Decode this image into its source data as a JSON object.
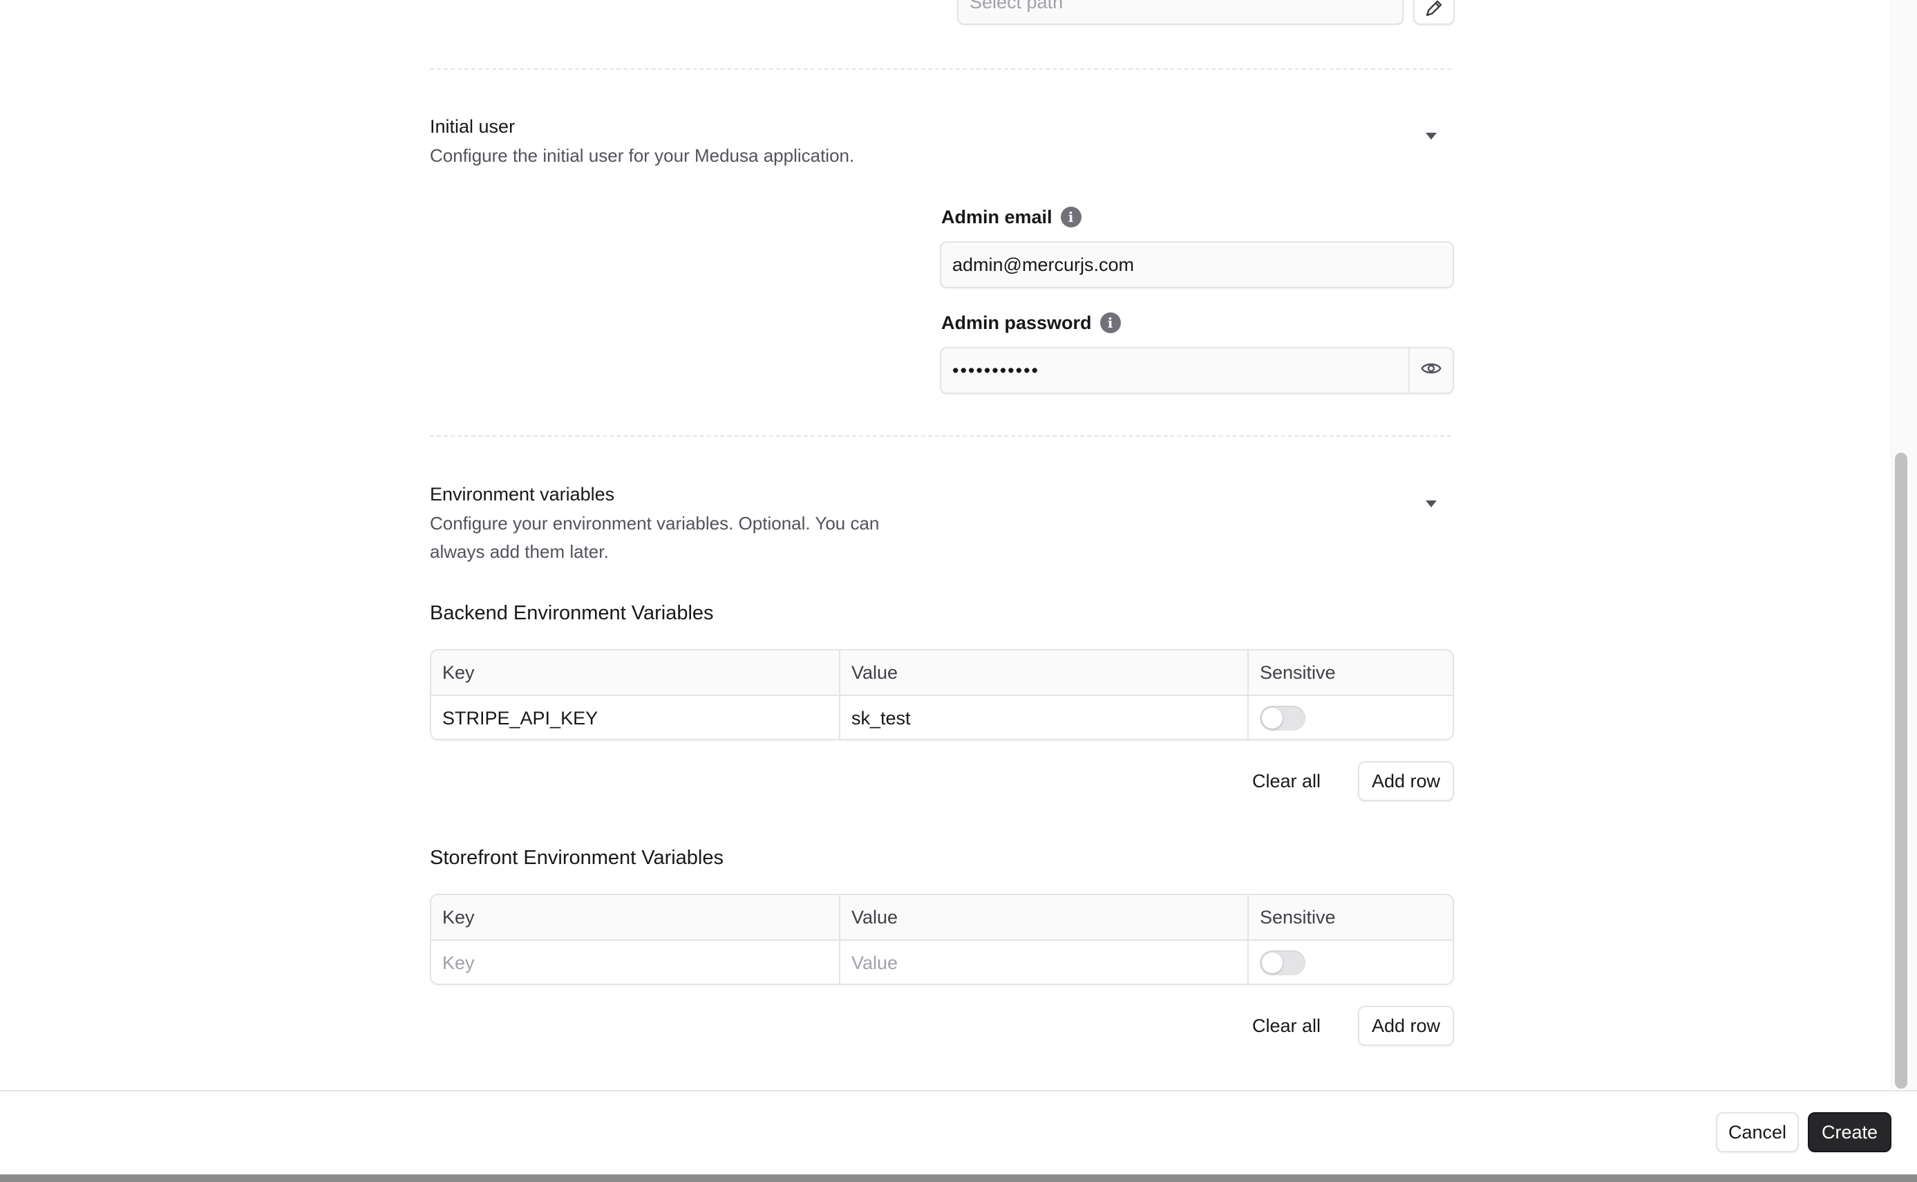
{
  "path_section": {
    "placeholder": "Select path"
  },
  "initial_user": {
    "title": "Initial user",
    "description": "Configure the initial user for your Medusa application.",
    "admin_email_label": "Admin email",
    "admin_email_value": "admin@mercurjs.com",
    "admin_password_label": "Admin password",
    "admin_password_value": "•••••••••••"
  },
  "env_vars": {
    "title": "Environment variables",
    "description_line1": "Configure your environment variables. Optional. You can",
    "description_line2": "always add them later.",
    "backend": {
      "title": "Backend Environment Variables",
      "headers": [
        "Key",
        "Value",
        "Sensitive"
      ],
      "rows": [
        {
          "key": "STRIPE_API_KEY",
          "value": "sk_test",
          "sensitive": false
        }
      ],
      "clear_label": "Clear all",
      "add_label": "Add row"
    },
    "storefront": {
      "title": "Storefront Environment Variables",
      "headers": [
        "Key",
        "Value",
        "Sensitive"
      ],
      "rows": [
        {
          "key_placeholder": "Key",
          "value_placeholder": "Value",
          "sensitive": false
        }
      ],
      "clear_label": "Clear all",
      "add_label": "Add row"
    }
  },
  "footer": {
    "cancel_label": "Cancel",
    "create_label": "Create"
  },
  "colors": {
    "primary_button": "#27272a",
    "border": "#e4e4e7",
    "muted_text": "#52525b",
    "scrollbar": "#c1c1c1"
  },
  "icons": {
    "edit": "pencil-icon",
    "info": "info-icon",
    "reveal": "eye-icon",
    "collapse": "chevron-down-icon"
  }
}
